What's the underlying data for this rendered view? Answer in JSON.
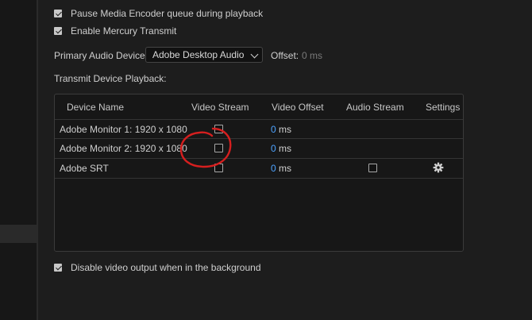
{
  "options": {
    "pause_queue": {
      "label": "Pause Media Encoder queue during playback",
      "checked": true
    },
    "enable_mercury": {
      "label": "Enable Mercury Transmit",
      "checked": true
    },
    "disable_background": {
      "label": "Disable video output when in the background",
      "checked": true
    }
  },
  "audio": {
    "label": "Primary Audio Device:",
    "device": "Adobe Desktop Audio",
    "offset_label": "Offset:",
    "offset_value": "0 ms"
  },
  "transmit": {
    "label": "Transmit Device Playback:",
    "headers": [
      "Device Name",
      "Video Stream",
      "Video Offset",
      "Audio Stream",
      "Settings"
    ],
    "rows": [
      {
        "name": "Adobe Monitor 1: 1920 x 1080",
        "video_stream": false,
        "offset_num": "0",
        "offset_unit": " ms"
      },
      {
        "name": "Adobe Monitor 2: 1920 x 1080",
        "video_stream": true,
        "offset_num": "0",
        "offset_unit": " ms"
      },
      {
        "name": "Adobe SRT",
        "video_stream": false,
        "offset_num": "0",
        "offset_unit": " ms",
        "audio_stream": false,
        "settings_icon": "gear-icon"
      }
    ]
  },
  "colors": {
    "accent": "#4da3ff",
    "annotation": "#d61f1f",
    "background": "#1d1d1d"
  }
}
